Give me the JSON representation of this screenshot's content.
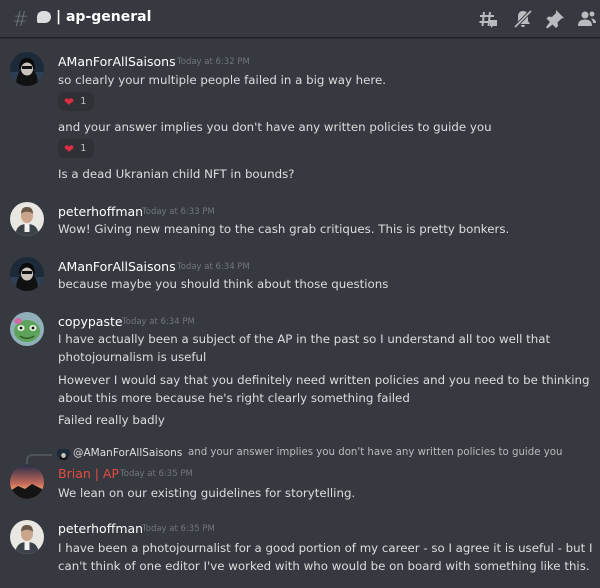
{
  "header": {
    "channel_name": "| ap-general",
    "icons": [
      "hash-icon",
      "chat-bubble-icon",
      "threads-icon",
      "mute-bell-icon",
      "pin-icon",
      "members-icon"
    ]
  },
  "messages": [
    {
      "author": "AManForAllSaisons",
      "author_color": "#ffffff",
      "timestamp": "Today at 6:32 PM",
      "avatar": "dark-hooded-figure-avatar",
      "lines": [
        "so clearly your multiple people failed in a big way here.",
        "and your answer implies you don't have any written policies to guide you",
        "Is a dead Ukranian child NFT in bounds?"
      ],
      "reactions": [
        {
          "emoji": "❤",
          "count": "1"
        },
        {
          "emoji": "❤",
          "count": "1"
        }
      ]
    },
    {
      "author": "peterhoffman",
      "author_color": "#ffffff",
      "timestamp": "Today at 6:33 PM",
      "avatar": "man-photo-avatar",
      "lines": [
        "Wow! Giving new meaning to the cash grab critiques. This is pretty bonkers."
      ]
    },
    {
      "author": "AManForAllSaisons",
      "author_color": "#ffffff",
      "timestamp": "Today at 6:34 PM",
      "avatar": "dark-hooded-figure-avatar",
      "lines": [
        "because maybe you should think about those questions"
      ]
    },
    {
      "author": "copypaste",
      "author_color": "#ffffff",
      "timestamp": "Today at 6:34 PM",
      "avatar": "green-cartoon-avatar",
      "lines": [
        "I have actually been a subject of the AP in the past so I understand all too well that",
        "photojournalism is useful",
        "However I would say that you definitely need written policies and you need to be thinking",
        "about this more because he's right  clearly something failed",
        "Failed really badly"
      ]
    },
    {
      "reply": {
        "mention": "@AManForAllSaisons",
        "text": "and your answer implies you don't have any written policies to guide you"
      },
      "author": "Brian | AP",
      "author_color": "#e74c3c",
      "timestamp": "Today at 6:35 PM",
      "avatar": "sunset-landscape-avatar",
      "lines": [
        "We lean on our existing guidelines for storytelling."
      ]
    },
    {
      "author": "peterhoffman",
      "author_color": "#ffffff",
      "timestamp": "Today at 6:35 PM",
      "avatar": "man-photo-avatar",
      "lines": [
        "I have been a photojournalist for a good portion of my career - so I agree it is useful - but I",
        "can't think of one editor I've worked with who would be on board with something like this."
      ]
    }
  ]
}
